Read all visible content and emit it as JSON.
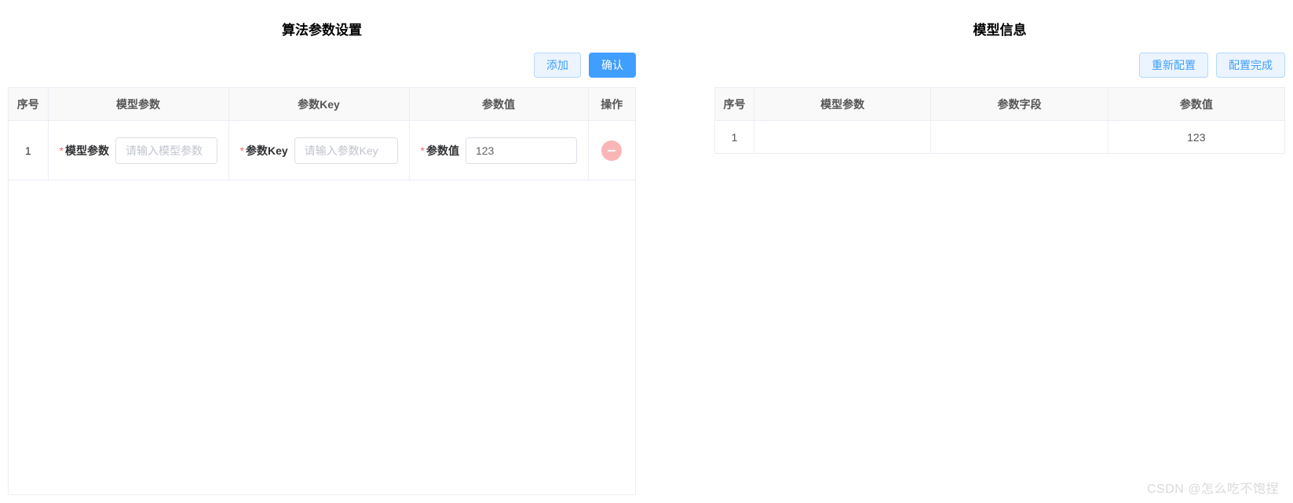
{
  "left": {
    "title": "算法参数设置",
    "buttons": {
      "add": "添加",
      "confirm": "确认"
    },
    "columns": {
      "seq": "序号",
      "modelParam": "模型参数",
      "paramKey": "参数Key",
      "paramValue": "参数值",
      "op": "操作"
    },
    "rows": [
      {
        "seq": "1",
        "modelParam": {
          "label": "模型参数",
          "placeholder": "请输入模型参数",
          "value": ""
        },
        "paramKey": {
          "label": "参数Key",
          "placeholder": "请输入参数Key",
          "value": ""
        },
        "paramValue": {
          "label": "参数值",
          "placeholder": "",
          "value": "123"
        }
      }
    ]
  },
  "right": {
    "title": "模型信息",
    "buttons": {
      "reconfig": "重新配置",
      "done": "配置完成"
    },
    "columns": {
      "seq": "序号",
      "modelParam": "模型参数",
      "paramField": "参数字段",
      "paramValue": "参数值"
    },
    "rows": [
      {
        "seq": "1",
        "modelParam": "",
        "paramField": "",
        "paramValue": "123"
      }
    ]
  },
  "watermark": "CSDN @怎么吃不饱捏"
}
